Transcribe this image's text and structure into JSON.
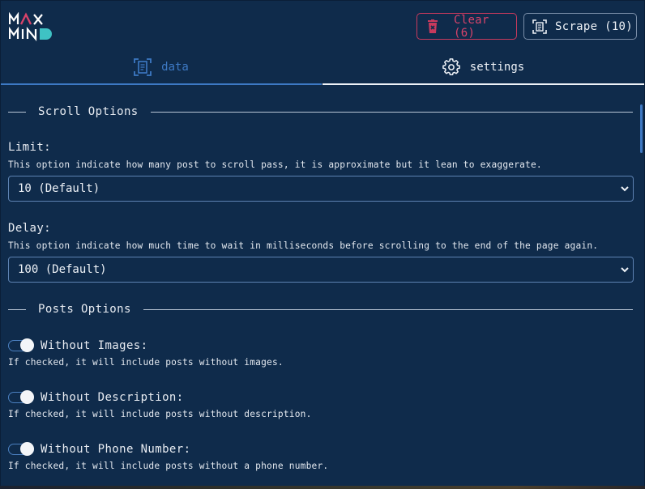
{
  "brand": {
    "logo_text_top": "MAX",
    "logo_text_bottom": "MIND",
    "accent": "#c83a5d",
    "primary": "#3d79c4",
    "background": "#0f2b4b"
  },
  "header": {
    "clear_label": "Clear (6)",
    "scrape_label": "Scrape (10)",
    "clear_icon": "trash-icon",
    "scrape_icon": "scan-document-icon"
  },
  "tabs": [
    {
      "label": "data",
      "icon": "scan-document-icon",
      "active": false
    },
    {
      "label": "settings",
      "icon": "gear-icon",
      "active": true
    }
  ],
  "sections": {
    "scroll": {
      "title": "Scroll Options",
      "limit": {
        "label": "Limit:",
        "description": "This option indicate how many post to scroll pass, it is approximate but it lean to exaggerate.",
        "value": "10 (Default)"
      },
      "delay": {
        "label": "Delay:",
        "description": "This option indicate how much time to wait in milliseconds before scrolling to the end of the page again.",
        "value": "100 (Default)"
      }
    },
    "posts": {
      "title": "Posts Options",
      "options": [
        {
          "label": "Without Images:",
          "description": "If checked, it will include posts without images.",
          "checked": true
        },
        {
          "label": "Without Description:",
          "description": "If checked, it will include posts without description.",
          "checked": true
        },
        {
          "label": "Without Phone Number:",
          "description": "If checked, it will include posts without a phone number.",
          "checked": true
        }
      ]
    }
  }
}
